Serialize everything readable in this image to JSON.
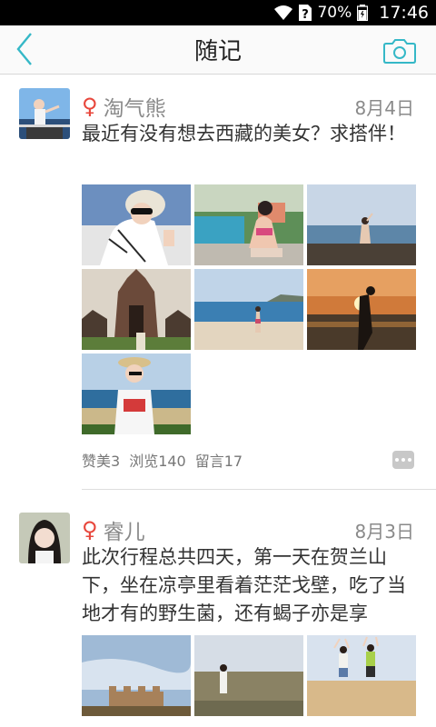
{
  "status_bar": {
    "battery_percent": "70%",
    "time": "17:46",
    "wifi_icon": "wifi-icon",
    "sim_icon": "sim-icon",
    "battery_icon": "battery-icon"
  },
  "app_bar": {
    "title": "随记",
    "back_icon": "chevron-left-icon",
    "camera_icon": "camera-icon",
    "accent_color": "#35b8c7"
  },
  "posts": [
    {
      "username": "淘气熊",
      "gender_symbol": "♀",
      "date": "8月4日",
      "content": "最近有没有想去西藏的美女？求搭伴！",
      "photos": [
        "photo-girl-sunglasses",
        "photo-pool-bikini",
        "photo-sea-rocks",
        "photo-temple",
        "photo-beach-yoga",
        "photo-sunset",
        "photo-girl-hat-beach"
      ],
      "stats": {
        "likes": "赞美3",
        "views": "浏览140",
        "comments": "留言17"
      }
    },
    {
      "username": "睿儿",
      "gender_symbol": "♀",
      "date": "8月3日",
      "content": "此次行程总共四天，第一天在贺兰山下，坐在凉亭里看着茫茫戈壁，吃了当地才有的野生菌，还有蝎子亦是享",
      "photos": [
        "photo-fort-sky",
        "photo-desert-girl",
        "photo-desert-jump"
      ]
    }
  ]
}
